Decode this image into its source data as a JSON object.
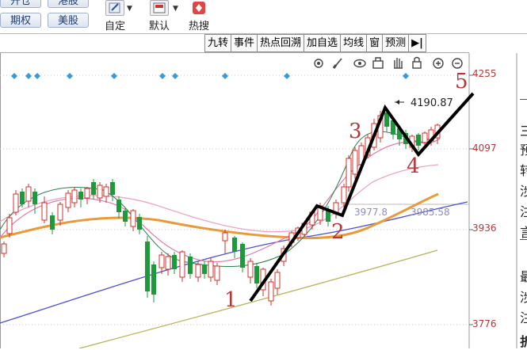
{
  "toolbar": {
    "buttons": [
      "开仓",
      "港股",
      "期权",
      "美股"
    ],
    "tools": [
      {
        "label": "自定",
        "icon": "pencil-icon"
      },
      {
        "label": "默认",
        "icon": "default-layout-icon"
      },
      {
        "label": "热搜",
        "icon": "hot-search-icon"
      }
    ]
  },
  "tabs": [
    "九转",
    "事件",
    "热点回溯",
    "加自选",
    "均线",
    "窗",
    "预测",
    "▶|"
  ],
  "chart_icons": [
    "gear-icon",
    "draw-icon",
    "eye-icon",
    "lock-box-icon",
    "hand-icon",
    "lock-icon",
    "zoom-in-icon",
    "zoom-out-icon"
  ],
  "price_axis": [
    "4255",
    "4097",
    "3936",
    "3776"
  ],
  "annotations": {
    "peak_label": "4190.87",
    "ma_readout": "3977.8",
    "ma_readout_2": "3985.58",
    "waves": [
      "1",
      "2",
      "3",
      "4",
      "5"
    ]
  },
  "right_panel_chars": [
    "三",
    "预",
    "转",
    "涉",
    "注",
    "言",
    "最",
    "涉",
    "注",
    "折"
  ],
  "colors": {
    "up": "#d0302b",
    "down": "#1e9a3c",
    "wave_line": "#000000",
    "ma_orange": "#e89b3a",
    "ma_blue": "#4b52c8",
    "ma_pink": "#e7a6c8",
    "ma_olive": "#b8b25a",
    "marker_blue": "#3a9ad9",
    "price_text": "#b03a3a"
  }
}
